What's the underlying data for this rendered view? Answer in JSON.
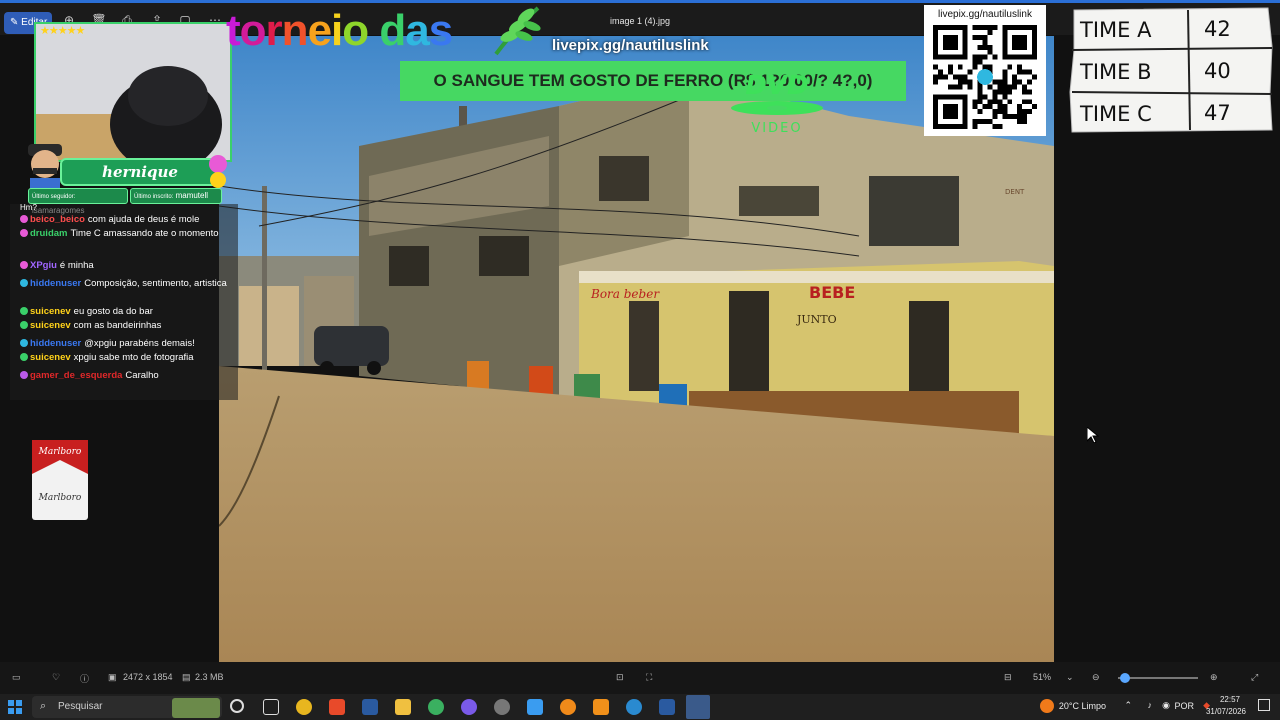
{
  "viewer": {
    "title": "image 1 (4).jpg",
    "edit_label": "Editar",
    "image_dimensions": "2472 x 1854",
    "file_size": "2.3 MB",
    "zoom": "51%"
  },
  "overlay": {
    "brand_title": [
      "t",
      "o",
      "r",
      "n",
      "e",
      "i",
      "o",
      " ",
      "d",
      "a",
      "s"
    ],
    "brand_colors": [
      "#c81bd6",
      "#d21b9a",
      "#e01c4a",
      "#f1522b",
      "#f7a21c",
      "#f7d21c",
      "#8ed62b",
      "#ffffff",
      "#3ad06a",
      "#2fb8e0",
      "#3a78f0"
    ],
    "livepix_link": "livepix.gg/nautiluslink",
    "banner_text": "O SANGUE TEM GOSTO DE FERRO (R$ 1?0,00/? 4?,0)",
    "dvd_text": "VIDEO",
    "qr_label": "livepix.gg/nautiluslink",
    "streamer_name": "hernique",
    "follower_label": "Último seguidor:",
    "follower_name": "isamaragomes",
    "sub_label": "Último inscrito:",
    "sub_name": "mamutell",
    "stars": "★★★★★",
    "cigarette_brand": "Marlboro"
  },
  "scoreboard": [
    {
      "team": "TIME A",
      "score": "42"
    },
    {
      "team": "TIME B",
      "score": "40"
    },
    {
      "team": "TIME C",
      "score": "47"
    }
  ],
  "chat": {
    "partial_top": "Hm?",
    "messages": [
      {
        "user": "beico_beico",
        "color": "#ff4d4d",
        "text": "com ajuda de deus é mole",
        "badge": "#e85ad6"
      },
      {
        "user": "druidam",
        "color": "#3ad06a",
        "text": "Time C amassando ate o momento",
        "badge": "#e85ad6"
      },
      {
        "user": "XPgiu",
        "color": "#a066ff",
        "text": "é minha",
        "badge": "#e85ad6"
      },
      {
        "user": "hiddenuser",
        "color": "#3a78f0",
        "text": "Composição, sentimento, artistica",
        "badge": "#2fb8e0"
      },
      {
        "user": "suicenev",
        "color": "#ffd21a",
        "text": "eu gosto da do bar",
        "badge": "#3ad06a"
      },
      {
        "user": "suicenev",
        "color": "#ffd21a",
        "text": "com as bandeirinhas",
        "badge": "#3ad06a"
      },
      {
        "user": "hiddenuser",
        "color": "#3a78f0",
        "text": "@xpgiu parabéns demais!",
        "badge": "#2fb8e0"
      },
      {
        "user": "suicenev",
        "color": "#ffd21a",
        "text": "xpgiu sabe mto de fotografia",
        "badge": "#3ad06a"
      },
      {
        "user": "gamer_de_esquerda",
        "color": "#e0282a",
        "text": "Caralho",
        "badge": "#b85ae8"
      }
    ]
  },
  "taskbar": {
    "search_placeholder": "Pesquisar",
    "weather": "20°C  Limpo",
    "language": "POR",
    "time": "22:57",
    "date": "31/07/2026"
  },
  "photo": {
    "signs": [
      "Bora beber",
      "BEBE",
      "JUNTO",
      "DENT PROTE RO SAN"
    ]
  }
}
